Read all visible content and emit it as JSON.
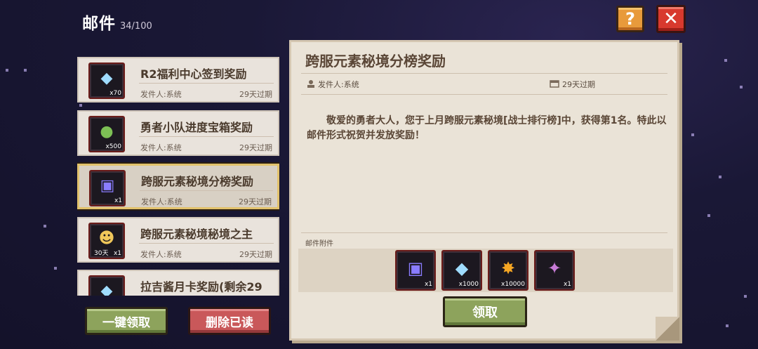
{
  "header": {
    "title": "邮件",
    "count": "34/100"
  },
  "buttons": {
    "help": "?",
    "close": "✕",
    "collect_all": "一键领取",
    "delete_read": "删除已读",
    "claim": "领取"
  },
  "mail_list": [
    {
      "title": "R2福利中心签到奖励",
      "sender": "发件人:系统",
      "expire": "29天过期",
      "qty": "x70",
      "icon": "diamond-icon",
      "selected": false
    },
    {
      "title": "勇者小队进度宝箱奖励",
      "sender": "发件人:系统",
      "expire": "29天过期",
      "qty": "x500",
      "icon": "green-medal-icon",
      "selected": false
    },
    {
      "title": "跨服元素秘境分榜奖励",
      "sender": "发件人:系统",
      "expire": "29天过期",
      "qty": "x1",
      "icon": "portal-scroll-icon",
      "selected": true
    },
    {
      "title": "跨服元素秘境秘境之主",
      "sender": "发件人:系统",
      "expire": "29天过期",
      "qty": "x1",
      "icon": "hero-portrait-icon",
      "subqty": "30天",
      "selected": false
    },
    {
      "title": "拉吉酱月卡奖励(剩余29",
      "sender": "",
      "expire": "",
      "qty": "",
      "icon": "diamond-icon",
      "selected": false
    }
  ],
  "detail": {
    "title": "跨服元素秘境分榜奖励",
    "sender": "发件人:系统",
    "expire": "29天过期",
    "body": "敬爱的勇者大人，您于上月跨服元素秘境[战士排行榜]中，获得第1名。特此以邮件形式祝贺并发放奖励！",
    "attachments_label": "邮件附件",
    "attachments": [
      {
        "icon": "portal-scroll-icon",
        "qty": "x1"
      },
      {
        "icon": "diamond-icon",
        "qty": "x1000"
      },
      {
        "icon": "gold-burst-icon",
        "qty": "x10000"
      },
      {
        "icon": "treasure-chest-icon",
        "qty": "x1"
      }
    ]
  }
}
